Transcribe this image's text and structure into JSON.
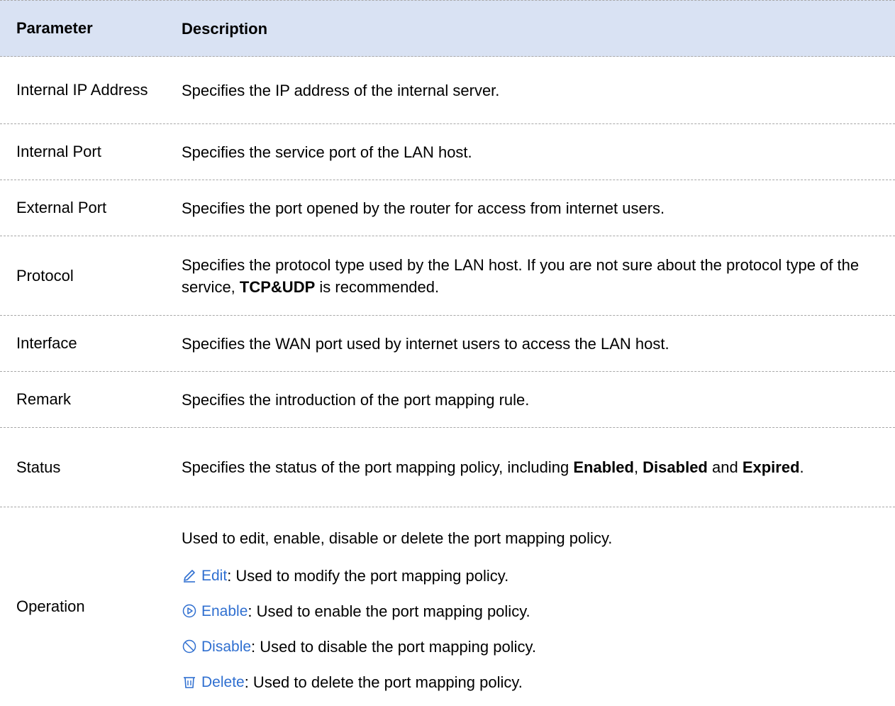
{
  "header": {
    "param": "Parameter",
    "desc": "Description"
  },
  "rows": [
    {
      "param": "Internal IP Address",
      "desc": "Specifies the IP address of the internal server."
    },
    {
      "param": "Internal Port",
      "desc": "Specifies the service port of the LAN host."
    },
    {
      "param": "External Port",
      "desc": "Specifies the port opened by the router for access from internet users."
    },
    {
      "param": "Protocol",
      "desc_a": "Specifies the protocol type used by the LAN host. If you are not sure about the protocol type of the service, ",
      "desc_b": "TCP&UDP",
      "desc_c": " is recommended."
    },
    {
      "param": "Interface",
      "desc": "Specifies the WAN port used by internet users to access the LAN host."
    },
    {
      "param": "Remark",
      "desc": "Specifies the introduction of the port mapping rule."
    },
    {
      "param": "Status",
      "desc_a": "Specifies the status of the port mapping policy, including ",
      "b1": "Enabled",
      "sep1": ", ",
      "b2": "Disabled",
      "sep2": " and ",
      "b3": "Expired",
      "end": "."
    },
    {
      "param": "Operation",
      "intro": "Used to edit, enable, disable or delete the port mapping policy."
    }
  ],
  "operations": [
    {
      "label": "Edit",
      "text": ": Used to modify the port mapping policy.",
      "icon": "pencil-icon"
    },
    {
      "label": "Enable",
      "text": ": Used to enable the port mapping policy.",
      "icon": "play-circle-icon"
    },
    {
      "label": "Disable",
      "text": ": Used to disable the port mapping policy.",
      "icon": "ban-icon"
    },
    {
      "label": "Delete",
      "text": ": Used to delete the port mapping policy.",
      "icon": "trash-icon"
    }
  ],
  "colors": {
    "header_bg": "#d9e2f3",
    "link_blue": "#2f6fd0",
    "divider": "#a8a8a8"
  }
}
